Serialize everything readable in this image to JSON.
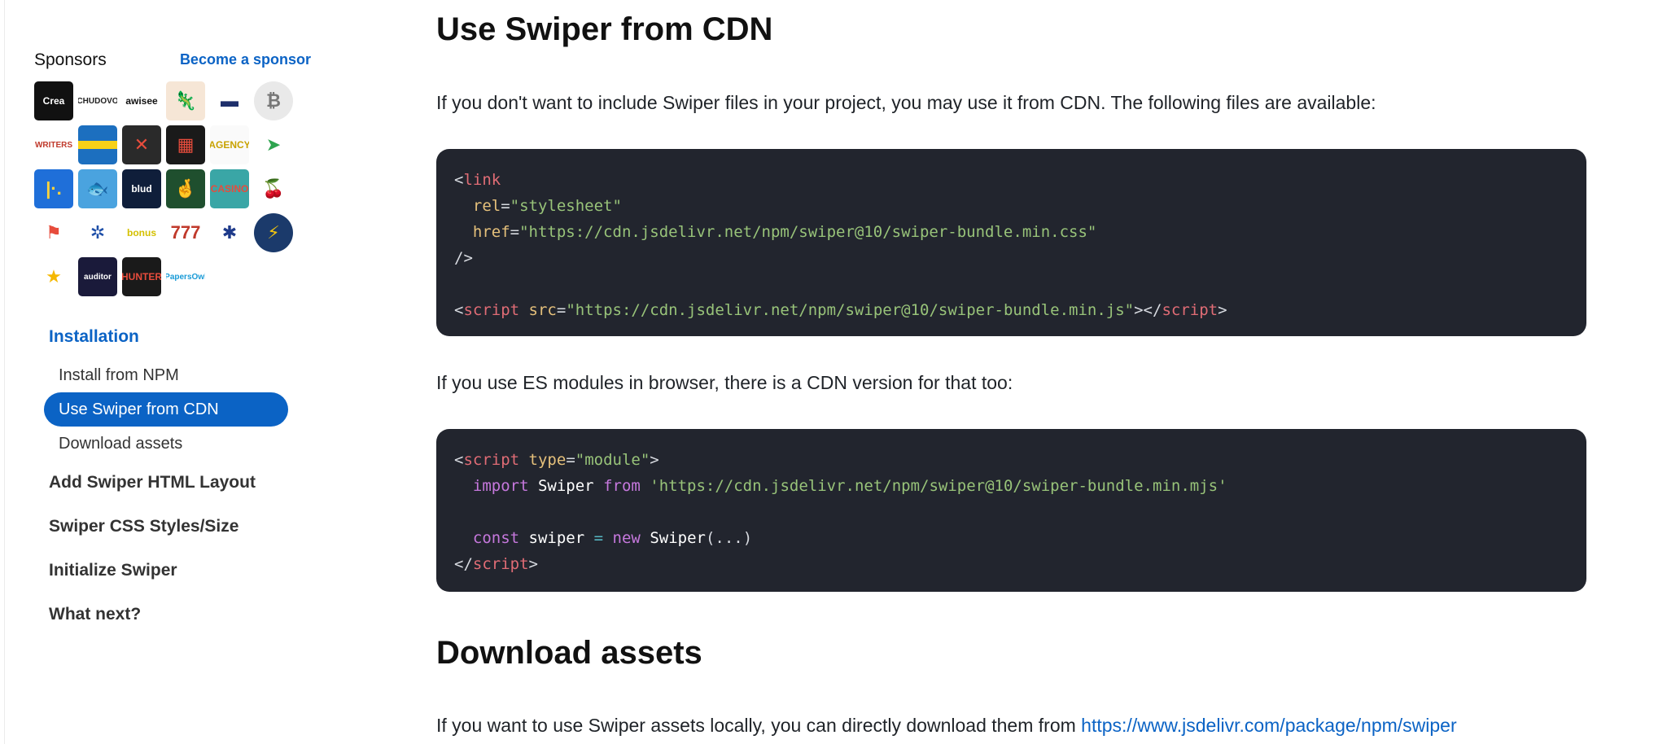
{
  "sidebar": {
    "sponsors_title": "Sponsors",
    "become_sponsor": "Become a sponsor",
    "sponsors": [
      {
        "label": "Crea",
        "bg": "#111111",
        "fg": "#ffffff",
        "icon": "creatoly-logo"
      },
      {
        "label": "CHUDOVO",
        "bg": "#ffffff",
        "fg": "#222222",
        "icon": "chudovo-logo"
      },
      {
        "label": "awisee",
        "bg": "#ffffff",
        "fg": "#111111",
        "icon": "awisee-logo"
      },
      {
        "label": "🦎",
        "bg": "#f6e6d6",
        "fg": "#a0522d",
        "icon": "lizard-logo"
      },
      {
        "label": "▬",
        "bg": "#ffffff",
        "fg": "#1e2f6b",
        "icon": "banner-logo"
      },
      {
        "label": "₿",
        "bg": "#e9e9e9",
        "fg": "#777777",
        "icon": "bitcoin-logo"
      },
      {
        "label": "WRITERS",
        "bg": "#ffffff",
        "fg": "#c0392b",
        "icon": "writers-logo"
      },
      {
        "label": "",
        "bg": "#1c6fbf",
        "fg": "#f7d117",
        "icon": "sweden-flag-logo"
      },
      {
        "label": "✕",
        "bg": "#2a2a2a",
        "fg": "#e74c3c",
        "icon": "cross-logo"
      },
      {
        "label": "▦",
        "bg": "#1a1a1a",
        "fg": "#e74c3c",
        "icon": "slot-machine-logo"
      },
      {
        "label": "AGENCY",
        "bg": "#fafafa",
        "fg": "#c8a200",
        "icon": "media-agency-logo"
      },
      {
        "label": "➤",
        "bg": "#ffffff",
        "fg": "#2ea44f",
        "icon": "arrow-logo"
      },
      {
        "label": "|·.",
        "bg": "#1f6fd9",
        "fg": "#ffd43b",
        "icon": "dots-logo"
      },
      {
        "label": "🐟",
        "bg": "#4aa3df",
        "fg": "#ffffff",
        "icon": "fish-logo"
      },
      {
        "label": "blud",
        "bg": "#0f1e3a",
        "fg": "#ffffff",
        "icon": "blue-square-logo"
      },
      {
        "label": "🤞",
        "bg": "#1f4f2e",
        "fg": "#f1c40f",
        "icon": "lucky-hand-logo"
      },
      {
        "label": "CASINO",
        "bg": "#3aa6a6",
        "fg": "#e74c3c",
        "icon": "casino-sign-logo"
      },
      {
        "label": "🍒",
        "bg": "#ffffff",
        "fg": "#d90b1c",
        "icon": "cherry-logo"
      },
      {
        "label": "⚑",
        "bg": "#ffffff",
        "fg": "#e74c3c",
        "icon": "flag-logo"
      },
      {
        "label": "✲",
        "bg": "#ffffff",
        "fg": "#1e4fa8",
        "icon": "wheel-logo"
      },
      {
        "label": "bonus",
        "bg": "#ffffff",
        "fg": "#d4c000",
        "icon": "bonus-logo"
      },
      {
        "label": "777",
        "bg": "#ffffff",
        "fg": "#c0392b",
        "icon": "777-logo"
      },
      {
        "label": "✱",
        "bg": "#ffffff",
        "fg": "#1e3a8a",
        "icon": "uk-flag-logo"
      },
      {
        "label": "⚡",
        "bg": "#1b3a6b",
        "fg": "#f1c40f",
        "icon": "lightning-logo"
      },
      {
        "label": "★",
        "bg": "#ffffff",
        "fg": "#f5b800",
        "icon": "star-logo"
      },
      {
        "label": "auditor",
        "bg": "#1a1a3a",
        "fg": "#ffffff",
        "icon": "auditor-logo"
      },
      {
        "label": "HUNTER",
        "bg": "#1a1a1a",
        "fg": "#e74c3c",
        "icon": "hunter-logo"
      },
      {
        "label": "PapersOwl",
        "bg": "#ffffff",
        "fg": "#1a9bd7",
        "icon": "papersowl-logo"
      }
    ],
    "nav": {
      "installation": "Installation",
      "install_npm": "Install from NPM",
      "use_cdn": "Use Swiper from CDN",
      "download_assets": "Download assets",
      "add_layout": "Add Swiper HTML Layout",
      "css_styles": "Swiper CSS Styles/Size",
      "initialize": "Initialize Swiper",
      "whats_next": "What next?"
    }
  },
  "main": {
    "h_cdn": "Use Swiper from CDN",
    "p_cdn": "If you don't want to include Swiper files in your project, you may use it from CDN. The following files are available:",
    "code1": {
      "lt": "<",
      "link": "link",
      "rel_attr": "rel",
      "eq": "=",
      "rel_val": "\"stylesheet\"",
      "href_attr": "href",
      "href_val": "\"https://cdn.jsdelivr.net/npm/swiper@10/swiper-bundle.min.css\"",
      "close": "/>",
      "script": "script",
      "src_attr": "src",
      "src_val": "\"https://cdn.jsdelivr.net/npm/swiper@10/swiper-bundle.min.js\"",
      "gt_lt_slash": "></",
      "gt": ">"
    },
    "p_es": "If you use ES modules in browser, there is a CDN version for that too:",
    "code2": {
      "lt": "<",
      "script": "script",
      "type_attr": "type",
      "eq": "=",
      "type_val": "\"module\"",
      "gt": ">",
      "import": "import",
      "swiper": "Swiper",
      "from": "from",
      "url": "'https://cdn.jsdelivr.net/npm/swiper@10/swiper-bundle.min.mjs'",
      "const": "const",
      "swiper_var": "swiper",
      "eq2": "=",
      "new": "new",
      "ctor": "Swiper",
      "args": "(...)",
      "close_lt": "</"
    },
    "h_download": "Download assets",
    "p_download": "If you want to use Swiper assets locally, you can directly download them from ",
    "download_link": "https://www.jsdelivr.com/package/npm/swiper"
  }
}
